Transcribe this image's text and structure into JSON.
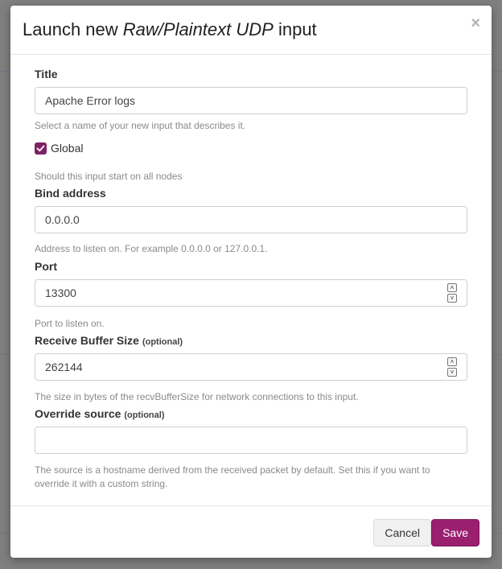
{
  "modal": {
    "title_prefix": "Launch new ",
    "title_type": "Raw/Plaintext UDP",
    "title_suffix": " input",
    "close_symbol": "×"
  },
  "fields": {
    "title": {
      "label": "Title",
      "value": "Apache Error logs",
      "help": "Select a name of your new input that describes it."
    },
    "global": {
      "label": "Global",
      "checked": true,
      "help": "Should this input start on all nodes"
    },
    "bind_address": {
      "label": "Bind address",
      "value": "0.0.0.0",
      "help": "Address to listen on. For example 0.0.0.0 or 127.0.0.1."
    },
    "port": {
      "label": "Port",
      "value": "13300",
      "help": "Port to listen on."
    },
    "recv_buffer": {
      "label": "Receive Buffer Size",
      "optional": "(optional)",
      "value": "262144",
      "help": "The size in bytes of the recvBufferSize for network connections to this input."
    },
    "override_source": {
      "label": "Override source",
      "optional": "(optional)",
      "value": "",
      "help": "The source is a hostname derived from the received packet by default. Set this if you want to override it with a custom string."
    }
  },
  "footer": {
    "cancel_label": "Cancel",
    "save_label": "Save"
  },
  "colors": {
    "accent": "#9b1f6f",
    "checkbox": "#7d2363"
  },
  "icons": {
    "close": "close-icon",
    "check": "check-icon",
    "spin_up": "chevron-up-icon",
    "spin_down": "chevron-down-icon"
  }
}
